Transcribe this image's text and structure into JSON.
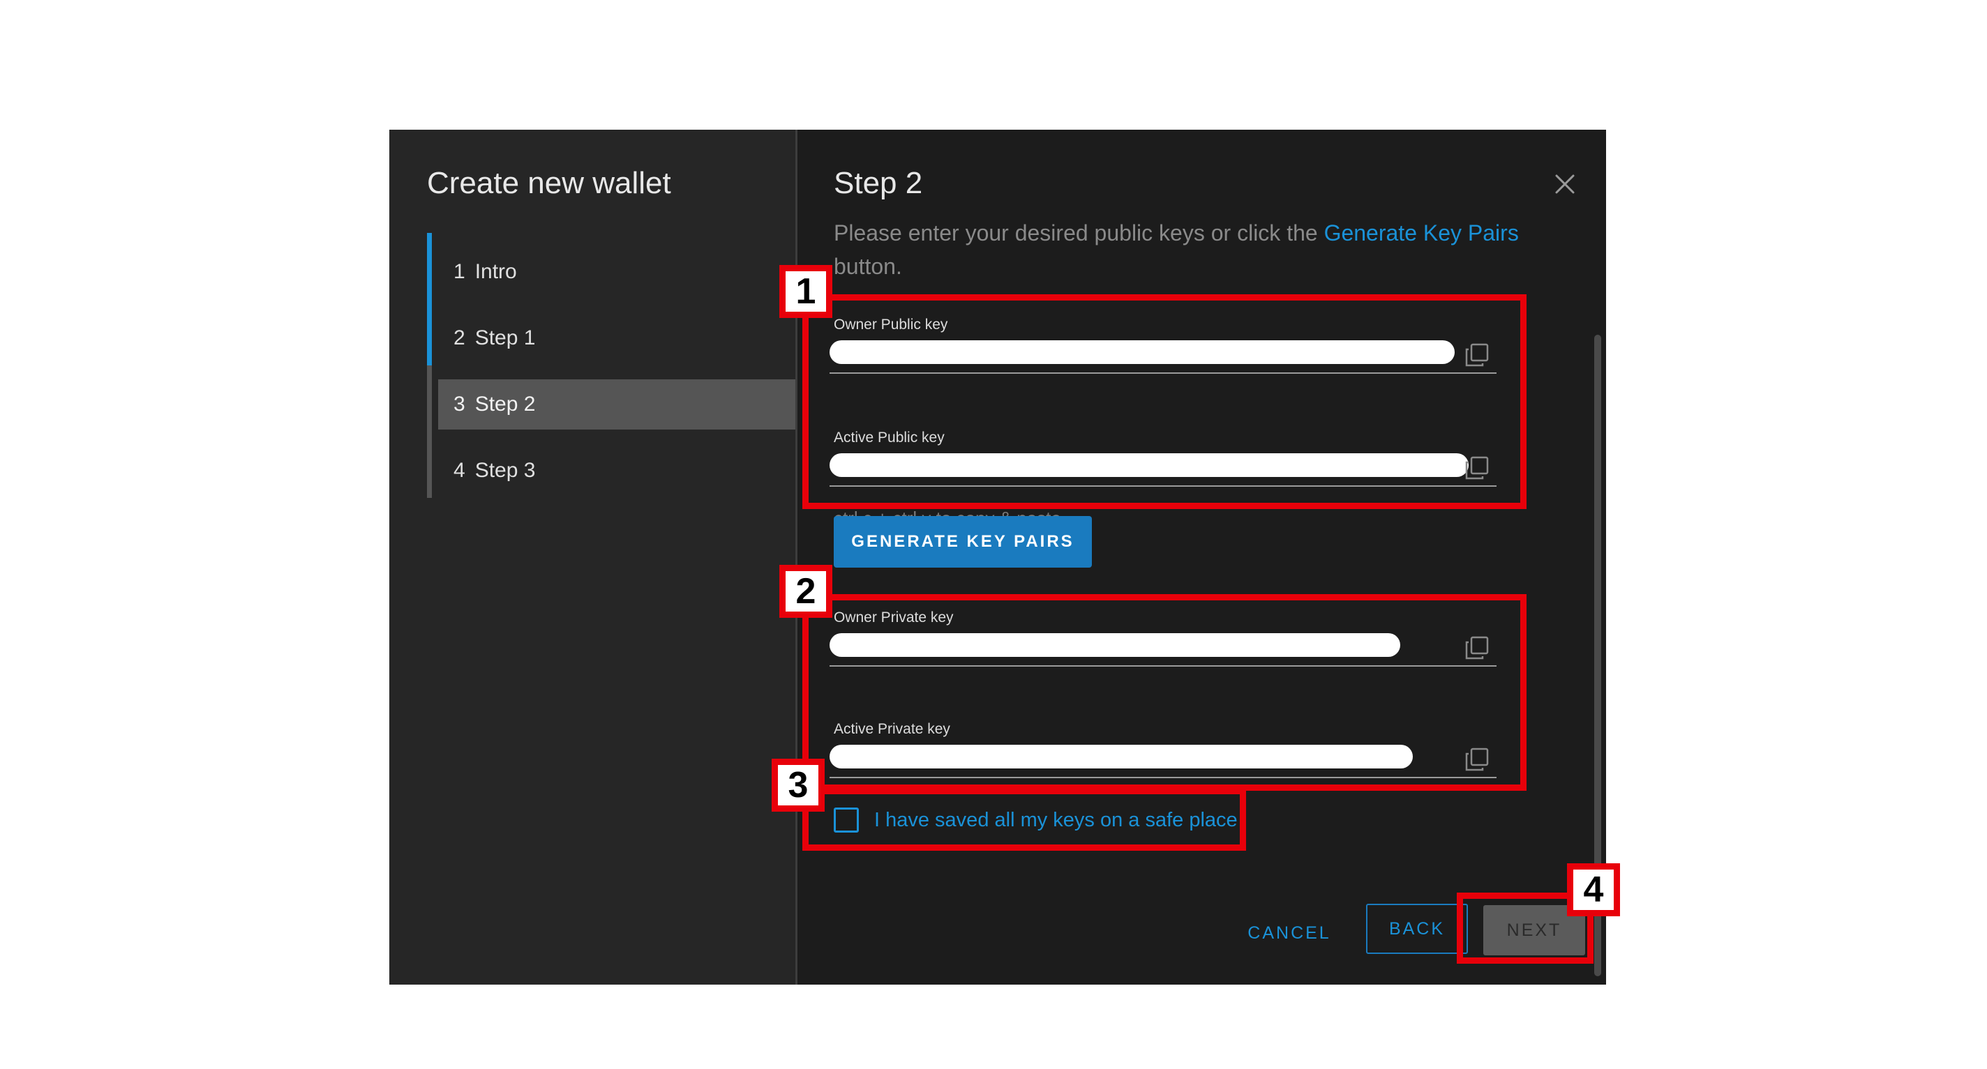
{
  "dialog": {
    "sidebar_title": "Create new wallet",
    "steps": [
      {
        "num": "1",
        "label": "Intro"
      },
      {
        "num": "2",
        "label": "Step 1"
      },
      {
        "num": "3",
        "label": "Step 2"
      },
      {
        "num": "4",
        "label": "Step 3"
      }
    ],
    "active_step": 3,
    "heading": "Step 2",
    "description_before": "Please enter your desired public keys or click the ",
    "description_link": "Generate Key Pairs",
    "description_after": " button.",
    "fields": {
      "owner_public": {
        "label": "Owner Public key"
      },
      "active_public": {
        "label": "Active Public key"
      },
      "owner_private": {
        "label": "Owner Private key"
      },
      "active_private": {
        "label": "Active Private key"
      }
    },
    "copy_hint": "ctrl c + ctrl v to copy & paste",
    "generate_button": "GENERATE KEY PAIRS",
    "checkbox_label": "I have saved all my keys on a safe place",
    "checkbox_checked": false,
    "buttons": {
      "cancel": "CANCEL",
      "back": "BACK",
      "next": "NEXT"
    }
  },
  "annotations": [
    "1",
    "2",
    "3",
    "4"
  ],
  "colors": {
    "accent": "#1a92d8",
    "annotation": "#e8000a",
    "modal_bg": "#1c1c1c",
    "sidebar_bg": "#262626"
  },
  "icons": {
    "close": "close-icon",
    "copy": "copy-icon"
  }
}
